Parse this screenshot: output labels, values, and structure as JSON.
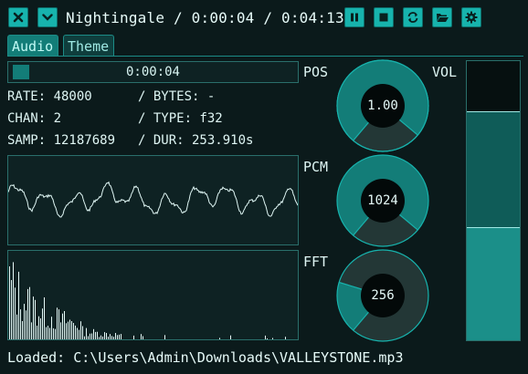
{
  "header": {
    "title": "Nightingale / 0:00:04 / 0:04:13"
  },
  "tabs": [
    {
      "label": "Audio",
      "active": true
    },
    {
      "label": "Theme",
      "active": false
    }
  ],
  "progress": {
    "time_label": "0:00:04",
    "fraction": 0.0158
  },
  "info": {
    "rate": "RATE: 48000",
    "bytes": "/ BYTES: -",
    "chan": "CHAN: 2",
    "type": "/ TYPE: f32",
    "samp": "SAMP: 12187689",
    "dur": "/ DUR: 253.910s"
  },
  "labels": {
    "pos": "POS",
    "pcm": "PCM",
    "fft": "FFT",
    "vol": "VOL"
  },
  "knobs": {
    "pos_value": "1.00",
    "pcm_value": "1024",
    "fft_value": "256"
  },
  "volume": {
    "level": 0.82
  },
  "status": {
    "text": "Loaded: C:\\Users\\Admin\\Downloads\\VALLEYSTONE.mp3"
  },
  "colors": {
    "accent": "#17b3ad",
    "panel_border": "#2a6f6b",
    "background": "#0b1a1b",
    "knob_fill": "#137d78",
    "knob_dark": "#233736"
  },
  "icons": [
    "close-icon",
    "chevron-down-icon",
    "pause-icon",
    "stop-icon",
    "repeat-icon",
    "folder-open-icon",
    "gear-icon"
  ]
}
